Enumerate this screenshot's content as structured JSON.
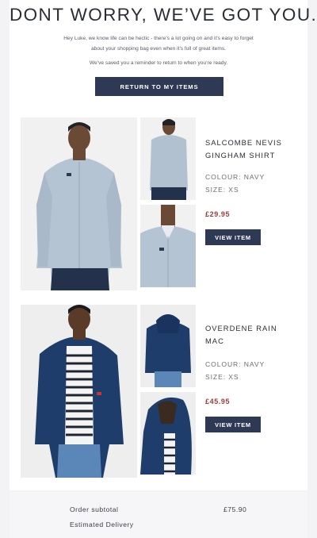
{
  "email": {
    "heading": "DONT WORRY, WE’VE GOT YOU.",
    "intro_line1": "Hey Luke, we know life can be hectic - there’s a lot going on and it’s easy to forget",
    "intro_line2": "about your shopping bag even when it’s full of great items.",
    "reminder": "We’ve saved you a reminder to return to when you’re ready.",
    "cta_label": "RETURN TO MY ITEMS"
  },
  "products": [
    {
      "name_line1": "SALCOMBE NEVIS",
      "name_line2": "GINGHAM SHIRT",
      "colour": "COLOUR: NAVY",
      "size": "SIZE: XS",
      "price": "£29.95",
      "button": "VIEW ITEM"
    },
    {
      "name_line1": "OVERDENE RAIN",
      "name_line2": "MAC",
      "colour": "COLOUR: NAVY",
      "size": "SIZE: XS",
      "price": "£45.95",
      "button": "VIEW ITEM"
    }
  ],
  "summary": {
    "subtotal_label": "Order subtotal",
    "subtotal_value": "£75.90",
    "delivery_label": "Estimated Delivery"
  },
  "colors": {
    "button_navy": "#2e3a55",
    "price_red": "#9b3b3b",
    "shirt_blue": "#aebfd0",
    "jacket_navy": "#1f3d6b"
  }
}
